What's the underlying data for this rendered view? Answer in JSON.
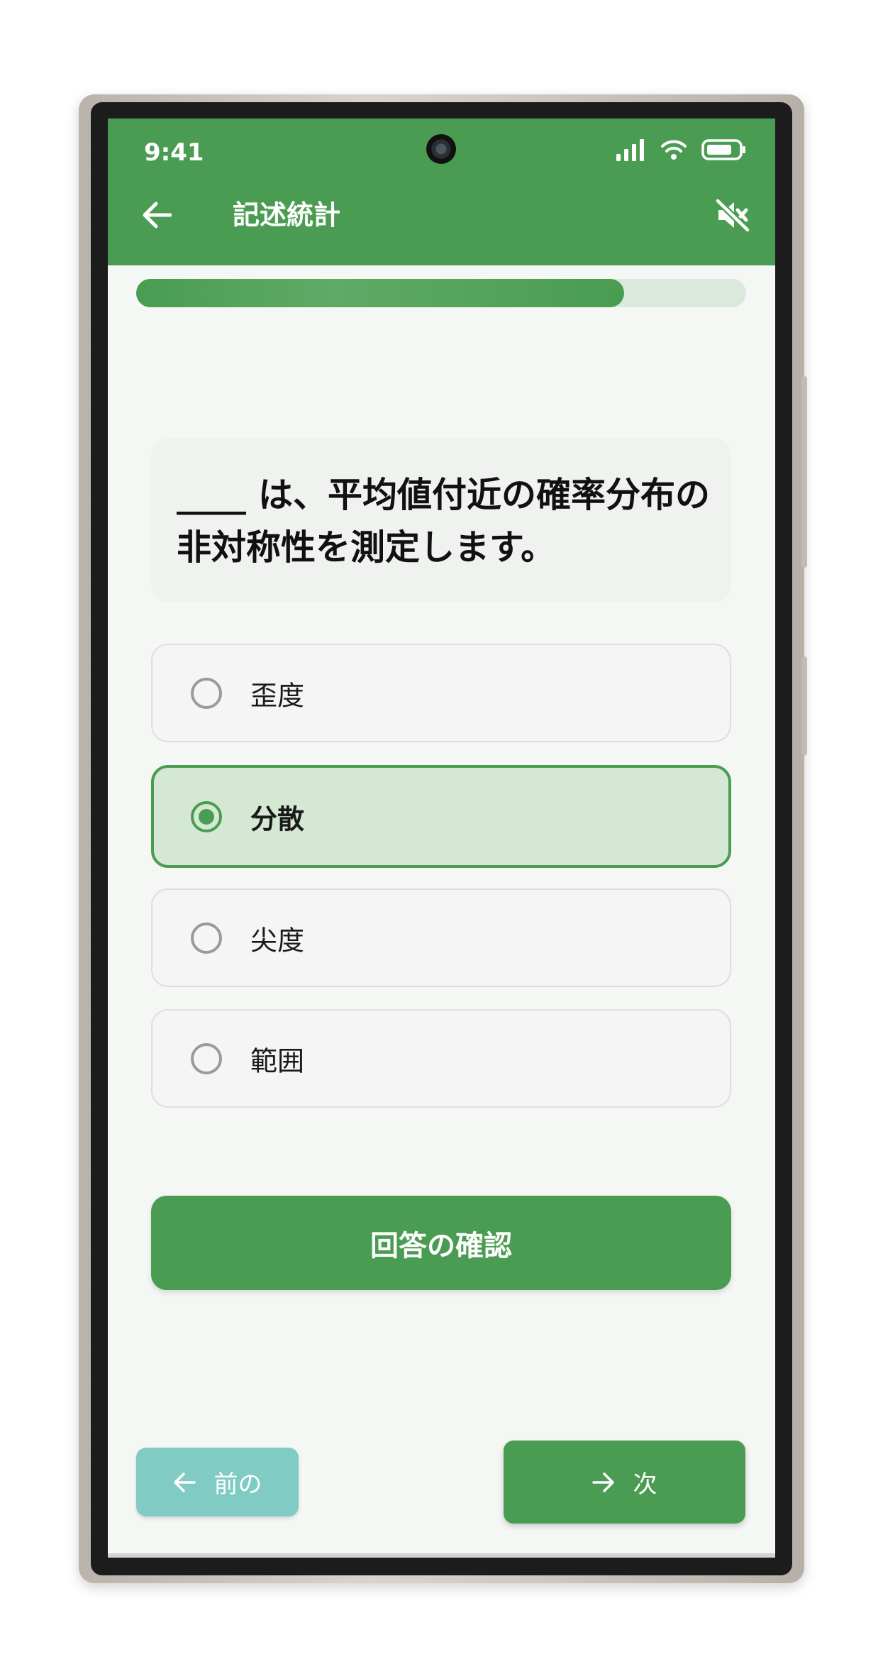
{
  "status_bar": {
    "time": "9:41"
  },
  "appbar": {
    "title": "記述統計",
    "back_icon": "arrow-left-icon",
    "mute_icon": "volume-off-icon"
  },
  "progress": {
    "fraction": 0.8
  },
  "question": {
    "text": "____ は、平均値付近の確率分布の非対称性を測定します。"
  },
  "options": [
    {
      "label": "歪度",
      "selected": false
    },
    {
      "label": "分散",
      "selected": true
    },
    {
      "label": "尖度",
      "selected": false
    },
    {
      "label": "範囲",
      "selected": false
    }
  ],
  "check_button": {
    "label": "回答の確認"
  },
  "nav": {
    "prev_label": "前の",
    "next_label": "次"
  },
  "colors": {
    "primary": "#4a9c52",
    "selected_bg": "#d4e8d4",
    "prev": "#80cbc4",
    "track": "#dbe9dc"
  }
}
